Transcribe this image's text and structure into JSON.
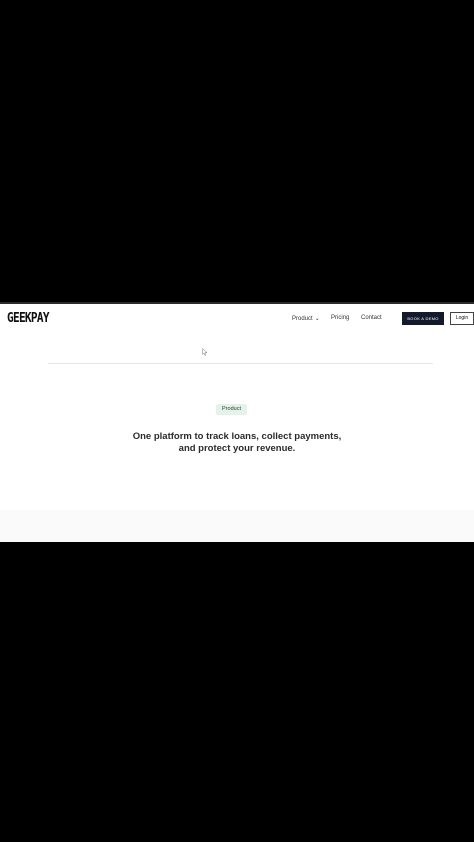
{
  "brand": {
    "logo_text": "GEEKPAY"
  },
  "nav": {
    "items": [
      {
        "label": "Product",
        "has_dropdown": true
      },
      {
        "label": "Pricing",
        "has_dropdown": false
      },
      {
        "label": "Contact",
        "has_dropdown": false
      }
    ],
    "dropdown_icon": "chevron-down-icon",
    "cta_primary": "BOOK A DEMO",
    "cta_secondary": "Login"
  },
  "hero": {
    "badge": "Product",
    "headline_line1": "One platform to track loans, collect payments,",
    "headline_line2": "and protect your revenue."
  },
  "colors": {
    "cta_primary_bg": "#141a2e",
    "badge_bg": "#e3f3ea",
    "page_bg": "#ffffff",
    "letterbox": "#000000"
  },
  "icons": {
    "cursor": "mouse-cursor-icon"
  }
}
